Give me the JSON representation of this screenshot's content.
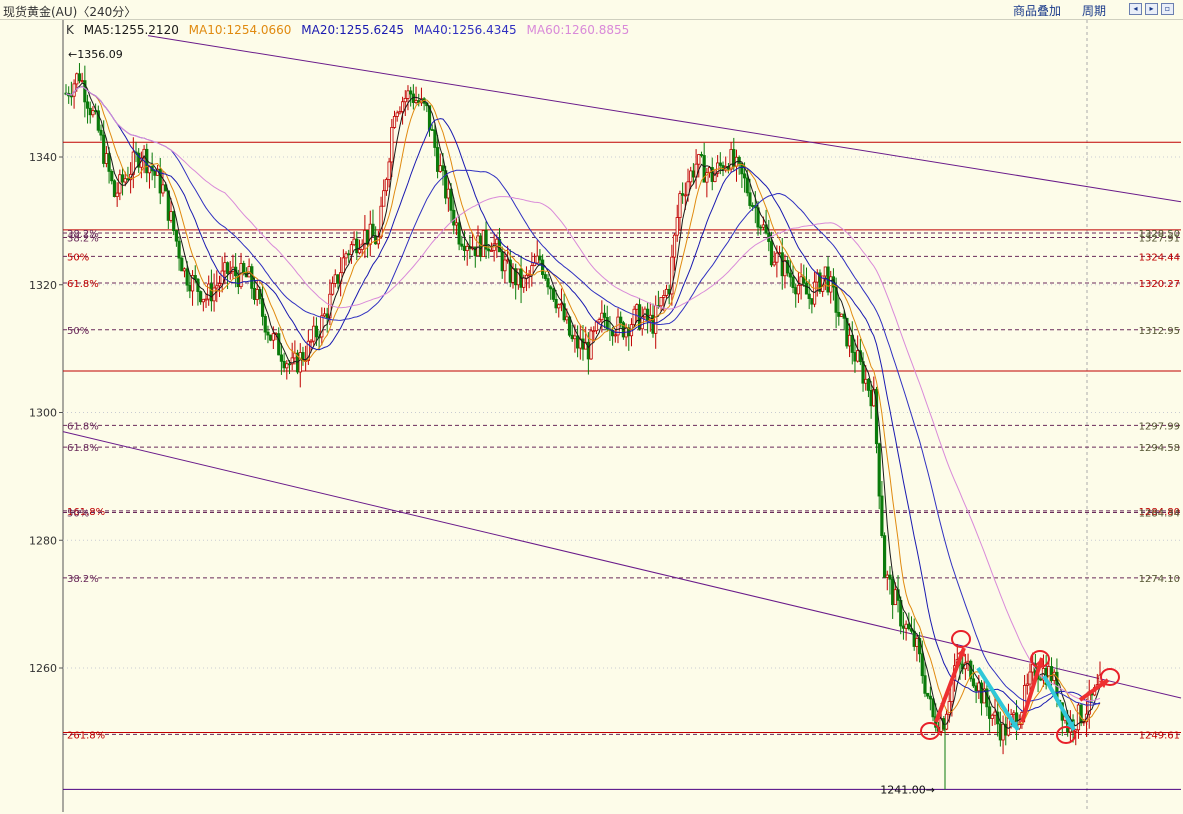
{
  "header": {
    "title": "现货黄金(AU)〈240分〉",
    "overlay_label": "商品叠加",
    "period_label": "周期"
  },
  "legend": {
    "k_label": "K",
    "items": [
      {
        "text": "MA5:1255.2120",
        "color": "#1a1a1a"
      },
      {
        "text": "MA10:1254.0660",
        "color": "#e08a10"
      },
      {
        "text": "MA20:1255.6245",
        "color": "#1a1ab0"
      },
      {
        "text": "MA40:1256.4345",
        "color": "#3030c0"
      },
      {
        "text": "MA60:1260.8855",
        "color": "#d98ad9"
      }
    ]
  },
  "chart_data": {
    "type": "candlestick",
    "y_range": [
      1238,
      1360
    ],
    "y_ticks": [
      1340,
      1320,
      1300,
      1280,
      1260
    ],
    "high_label": "1356.09",
    "low_label": "1241.00",
    "fib_lines": [
      {
        "value": 1328.6,
        "left": "",
        "right": "",
        "color": "#b33",
        "dash": false
      },
      {
        "value": 1328.1,
        "left": "38.2%",
        "right": "1328.50",
        "color": "#553",
        "dash": true
      },
      {
        "value": 1327.4,
        "left": "38.2%",
        "right": "1327.91",
        "color": "#553",
        "dash": true
      },
      {
        "value": 1324.44,
        "left": "50%",
        "right": "1324.44",
        "color": "#b33",
        "dash": true
      },
      {
        "value": 1320.27,
        "left": "61.8%",
        "right": "1320.27",
        "color": "#b33",
        "dash": true
      },
      {
        "value": 1312.95,
        "left": "50%",
        "right": "1312.95",
        "color": "#553",
        "dash": true
      },
      {
        "value": 1297.99,
        "left": "61.8%",
        "right": "1297.99",
        "color": "#553",
        "dash": true
      },
      {
        "value": 1294.58,
        "left": "61.8%",
        "right": "1294.58",
        "color": "#553",
        "dash": true
      },
      {
        "value": 1284.6,
        "left": "161.8%",
        "right": "1284.80",
        "color": "#b33",
        "dash": true
      },
      {
        "value": 1284.34,
        "left": "50%",
        "right": "1284.34",
        "color": "#553",
        "dash": true
      },
      {
        "value": 1274.1,
        "left": "38.2%",
        "right": "1274.10",
        "color": "#553",
        "dash": true
      },
      {
        "value": 1249.61,
        "left": "261.8%",
        "right": "1249.61",
        "color": "#b33",
        "dash": true
      }
    ],
    "horizontal_levels": [
      {
        "value": 1342.3,
        "color": "#c00000"
      },
      {
        "value": 1306.5,
        "color": "#c00000"
      },
      {
        "value": 1249.9,
        "color": "#c00000"
      },
      {
        "value": 1241.0,
        "color": "#4b0082"
      }
    ],
    "channel_lines": [
      {
        "x0": 0,
        "y0": 1360,
        "x1": 1,
        "y1": 1334,
        "color": "#6a1b8a"
      },
      {
        "x0": 0,
        "y0": 1297,
        "x1": 1,
        "y1": 1256,
        "color": "#6a1b8a"
      }
    ],
    "candle_count": 250
  },
  "colors": {
    "up": "#c00000",
    "down": "#0a7a0a",
    "grid_h": "#9aa0b0",
    "axis": "#444"
  }
}
